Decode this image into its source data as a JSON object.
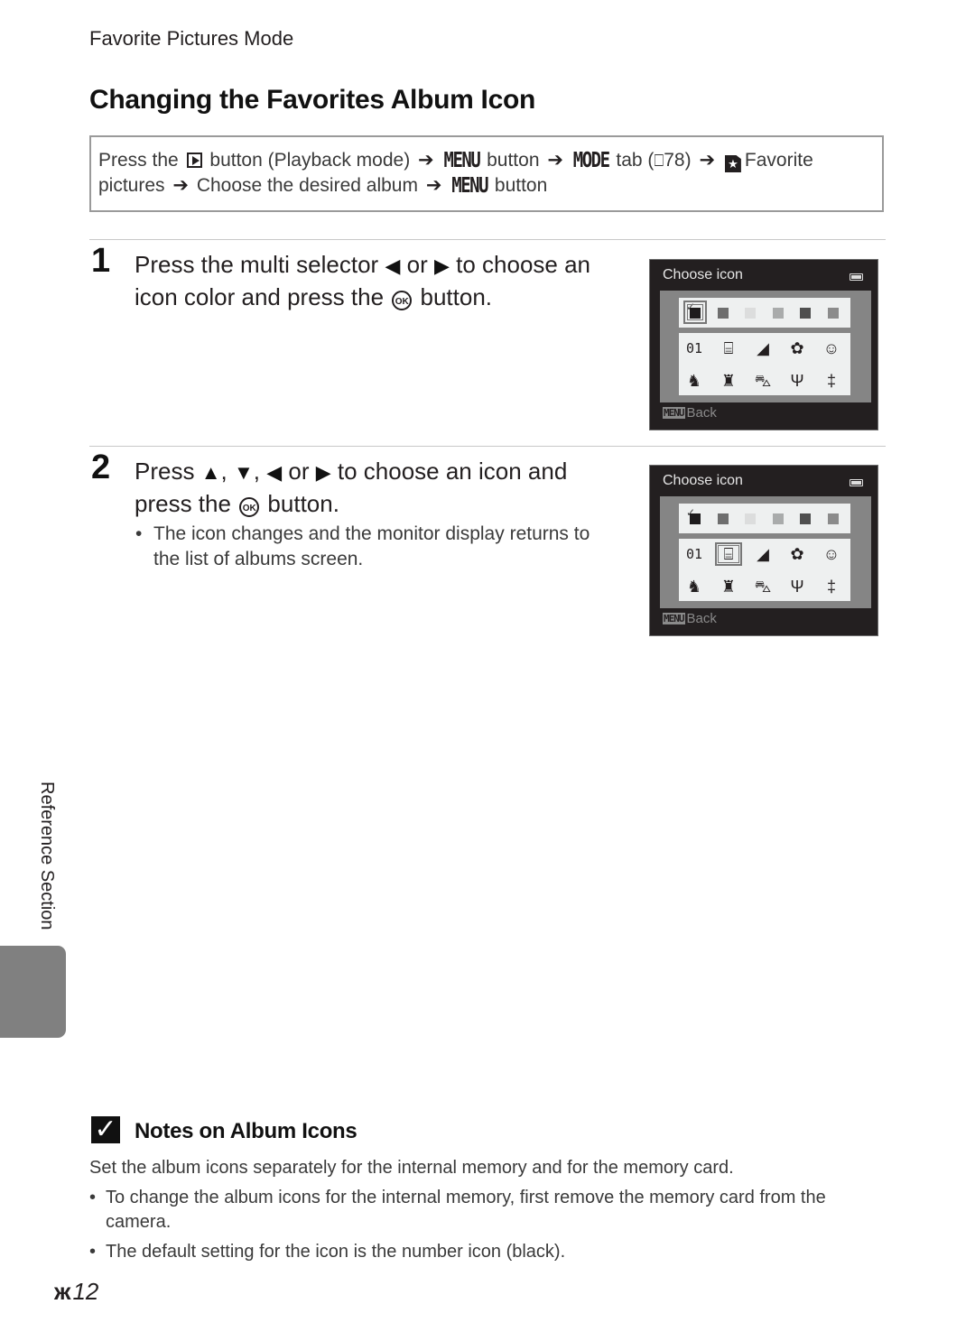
{
  "header": {
    "section": "Favorite Pictures Mode",
    "title": "Changing the Favorites Album Icon"
  },
  "path": {
    "press_the": "Press the",
    "button_playback": "button (Playback mode)",
    "menu_key": "MENU",
    "button": "button",
    "mode_key": "MODE",
    "tab_ref_open": "tab (",
    "tab_ref_page": "78)",
    "favorite": "Favorite",
    "pictures": "pictures",
    "choose_album": "Choose the desired album",
    "menu_key_2": "MENU",
    "button_2": "button",
    "book_glyph": "⎕",
    "arrow_glyph": "➔",
    "fav_glyph": "★"
  },
  "steps": [
    {
      "number": "1",
      "line1_a": "Press the multi selector",
      "line1_b": "or",
      "line1_c": "to choose an",
      "line2_a": "icon color and press the",
      "line2_b": "button.",
      "ok_label": "OK",
      "left_glyph": "◀",
      "right_glyph": "▶"
    },
    {
      "number": "2",
      "line1_a": "Press",
      "line1_up": "▲",
      "line1_sep1": ",",
      "line1_down": "▼",
      "line1_sep2": ",",
      "line1_left": "◀",
      "line1_or": "or",
      "line1_right": "▶",
      "line1_b": "to choose an icon and",
      "line2_a": "press the",
      "line2_b": "button.",
      "ok_label": "OK",
      "bullets": [
        "The icon changes and the monitor display returns to the list of albums screen."
      ]
    }
  ],
  "screens": [
    {
      "title": "Choose icon",
      "back_key": "MENU",
      "back_label": "Back",
      "selected_color_index": 0,
      "selected_icon_index": null
    },
    {
      "title": "Choose icon",
      "back_key": "MENU",
      "back_label": "Back",
      "selected_color_index": null,
      "selected_icon_index": 1
    }
  ],
  "icon_colors": [
    "#1e1c1d",
    "#6e6e6e",
    "#dcdddd",
    "#a9abab",
    "#4f4f4f",
    "#8b8b8b"
  ],
  "icons": [
    {
      "name": "number-icon",
      "glyph": "01"
    },
    {
      "name": "suitcase-icon",
      "glyph": "⌸"
    },
    {
      "name": "mountain-icon",
      "glyph": "◢"
    },
    {
      "name": "flower-icon",
      "glyph": "✿"
    },
    {
      "name": "face-icon",
      "glyph": "☺"
    },
    {
      "name": "cat-icon",
      "glyph": "♞"
    },
    {
      "name": "castle-icon",
      "glyph": "♜"
    },
    {
      "name": "car-icon",
      "glyph": "⛍"
    },
    {
      "name": "cocktail-icon",
      "glyph": "Ψ"
    },
    {
      "name": "cutlery-icon",
      "glyph": "‡"
    }
  ],
  "side_tab": {
    "label": "Reference Section"
  },
  "note": {
    "title": "Notes on Album Icons",
    "intro": "Set the album icons separately for the internal memory and for the memory card.",
    "bullets": [
      "To change the album icons for the internal memory, first remove the memory card from the camera.",
      "The default setting for the icon is the number icon (black)."
    ]
  },
  "footer": {
    "ref_glyph": "ж",
    "page": "12"
  }
}
